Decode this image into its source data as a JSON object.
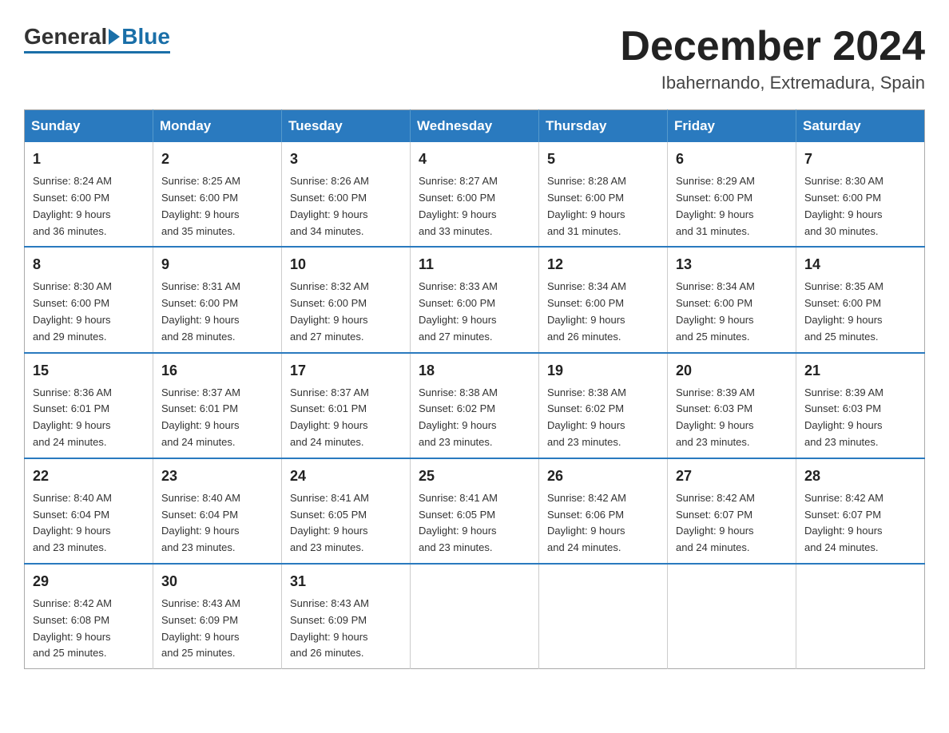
{
  "header": {
    "logo": {
      "general": "General",
      "blue": "Blue"
    },
    "title": "December 2024",
    "location": "Ibahernando, Extremadura, Spain"
  },
  "calendar": {
    "weekdays": [
      "Sunday",
      "Monday",
      "Tuesday",
      "Wednesday",
      "Thursday",
      "Friday",
      "Saturday"
    ],
    "weeks": [
      [
        {
          "day": "1",
          "sunrise": "8:24 AM",
          "sunset": "6:00 PM",
          "daylight": "9 hours and 36 minutes."
        },
        {
          "day": "2",
          "sunrise": "8:25 AM",
          "sunset": "6:00 PM",
          "daylight": "9 hours and 35 minutes."
        },
        {
          "day": "3",
          "sunrise": "8:26 AM",
          "sunset": "6:00 PM",
          "daylight": "9 hours and 34 minutes."
        },
        {
          "day": "4",
          "sunrise": "8:27 AM",
          "sunset": "6:00 PM",
          "daylight": "9 hours and 33 minutes."
        },
        {
          "day": "5",
          "sunrise": "8:28 AM",
          "sunset": "6:00 PM",
          "daylight": "9 hours and 31 minutes."
        },
        {
          "day": "6",
          "sunrise": "8:29 AM",
          "sunset": "6:00 PM",
          "daylight": "9 hours and 31 minutes."
        },
        {
          "day": "7",
          "sunrise": "8:30 AM",
          "sunset": "6:00 PM",
          "daylight": "9 hours and 30 minutes."
        }
      ],
      [
        {
          "day": "8",
          "sunrise": "8:30 AM",
          "sunset": "6:00 PM",
          "daylight": "9 hours and 29 minutes."
        },
        {
          "day": "9",
          "sunrise": "8:31 AM",
          "sunset": "6:00 PM",
          "daylight": "9 hours and 28 minutes."
        },
        {
          "day": "10",
          "sunrise": "8:32 AM",
          "sunset": "6:00 PM",
          "daylight": "9 hours and 27 minutes."
        },
        {
          "day": "11",
          "sunrise": "8:33 AM",
          "sunset": "6:00 PM",
          "daylight": "9 hours and 27 minutes."
        },
        {
          "day": "12",
          "sunrise": "8:34 AM",
          "sunset": "6:00 PM",
          "daylight": "9 hours and 26 minutes."
        },
        {
          "day": "13",
          "sunrise": "8:34 AM",
          "sunset": "6:00 PM",
          "daylight": "9 hours and 25 minutes."
        },
        {
          "day": "14",
          "sunrise": "8:35 AM",
          "sunset": "6:00 PM",
          "daylight": "9 hours and 25 minutes."
        }
      ],
      [
        {
          "day": "15",
          "sunrise": "8:36 AM",
          "sunset": "6:01 PM",
          "daylight": "9 hours and 24 minutes."
        },
        {
          "day": "16",
          "sunrise": "8:37 AM",
          "sunset": "6:01 PM",
          "daylight": "9 hours and 24 minutes."
        },
        {
          "day": "17",
          "sunrise": "8:37 AM",
          "sunset": "6:01 PM",
          "daylight": "9 hours and 24 minutes."
        },
        {
          "day": "18",
          "sunrise": "8:38 AM",
          "sunset": "6:02 PM",
          "daylight": "9 hours and 23 minutes."
        },
        {
          "day": "19",
          "sunrise": "8:38 AM",
          "sunset": "6:02 PM",
          "daylight": "9 hours and 23 minutes."
        },
        {
          "day": "20",
          "sunrise": "8:39 AM",
          "sunset": "6:03 PM",
          "daylight": "9 hours and 23 minutes."
        },
        {
          "day": "21",
          "sunrise": "8:39 AM",
          "sunset": "6:03 PM",
          "daylight": "9 hours and 23 minutes."
        }
      ],
      [
        {
          "day": "22",
          "sunrise": "8:40 AM",
          "sunset": "6:04 PM",
          "daylight": "9 hours and 23 minutes."
        },
        {
          "day": "23",
          "sunrise": "8:40 AM",
          "sunset": "6:04 PM",
          "daylight": "9 hours and 23 minutes."
        },
        {
          "day": "24",
          "sunrise": "8:41 AM",
          "sunset": "6:05 PM",
          "daylight": "9 hours and 23 minutes."
        },
        {
          "day": "25",
          "sunrise": "8:41 AM",
          "sunset": "6:05 PM",
          "daylight": "9 hours and 23 minutes."
        },
        {
          "day": "26",
          "sunrise": "8:42 AM",
          "sunset": "6:06 PM",
          "daylight": "9 hours and 24 minutes."
        },
        {
          "day": "27",
          "sunrise": "8:42 AM",
          "sunset": "6:07 PM",
          "daylight": "9 hours and 24 minutes."
        },
        {
          "day": "28",
          "sunrise": "8:42 AM",
          "sunset": "6:07 PM",
          "daylight": "9 hours and 24 minutes."
        }
      ],
      [
        {
          "day": "29",
          "sunrise": "8:42 AM",
          "sunset": "6:08 PM",
          "daylight": "9 hours and 25 minutes."
        },
        {
          "day": "30",
          "sunrise": "8:43 AM",
          "sunset": "6:09 PM",
          "daylight": "9 hours and 25 minutes."
        },
        {
          "day": "31",
          "sunrise": "8:43 AM",
          "sunset": "6:09 PM",
          "daylight": "9 hours and 26 minutes."
        },
        null,
        null,
        null,
        null
      ]
    ],
    "labels": {
      "sunrise": "Sunrise:",
      "sunset": "Sunset:",
      "daylight": "Daylight:"
    }
  }
}
